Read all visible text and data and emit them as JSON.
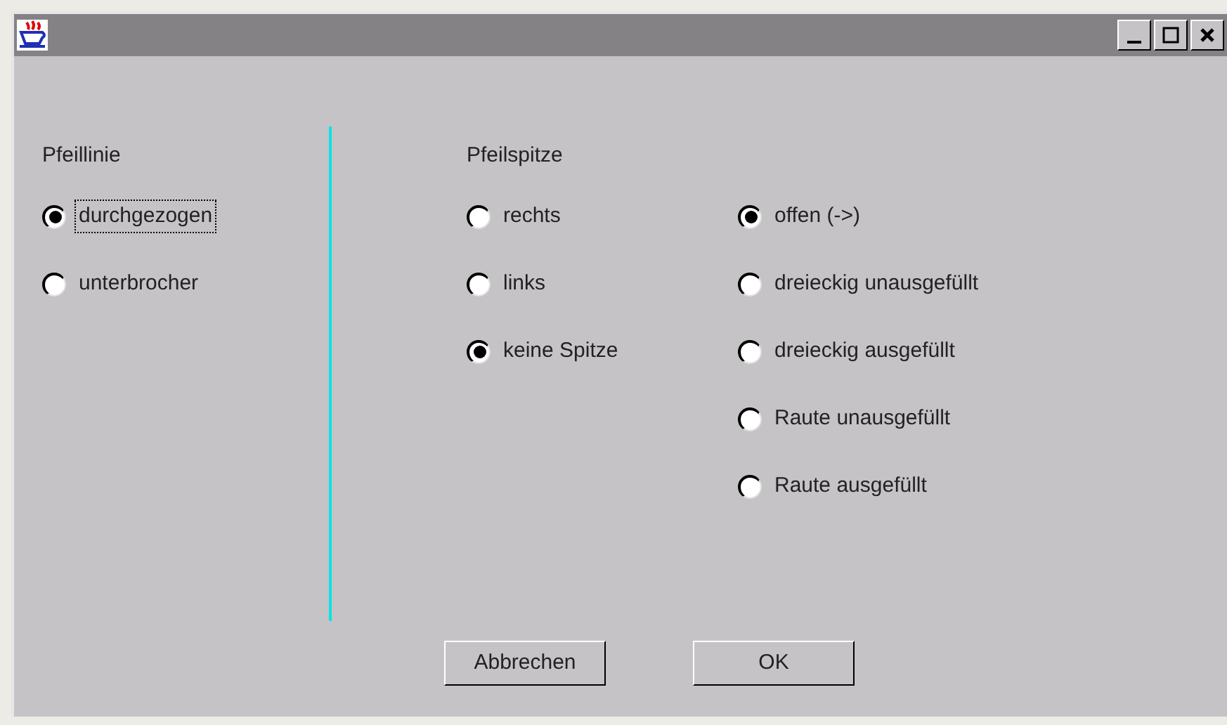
{
  "line_group": {
    "label": "Pfeillinie",
    "options": [
      {
        "label": "durchgezogen",
        "selected": true,
        "focused": true
      },
      {
        "label": "unterbrocher",
        "selected": false,
        "focused": false
      }
    ]
  },
  "head_group": {
    "label": "Pfeilspitze",
    "direction_options": [
      {
        "label": "rechts",
        "selected": false
      },
      {
        "label": "links",
        "selected": false
      },
      {
        "label": "keine Spitze",
        "selected": true
      }
    ],
    "style_options": [
      {
        "label": "offen (->)",
        "selected": true
      },
      {
        "label": "dreieckig unausgefüllt",
        "selected": false
      },
      {
        "label": "dreieckig ausgefüllt",
        "selected": false
      },
      {
        "label": "Raute unausgefüllt",
        "selected": false
      },
      {
        "label": "Raute ausgefüllt",
        "selected": false
      }
    ]
  },
  "buttons": [
    {
      "label": "Abbrechen"
    },
    {
      "label": "OK"
    }
  ]
}
